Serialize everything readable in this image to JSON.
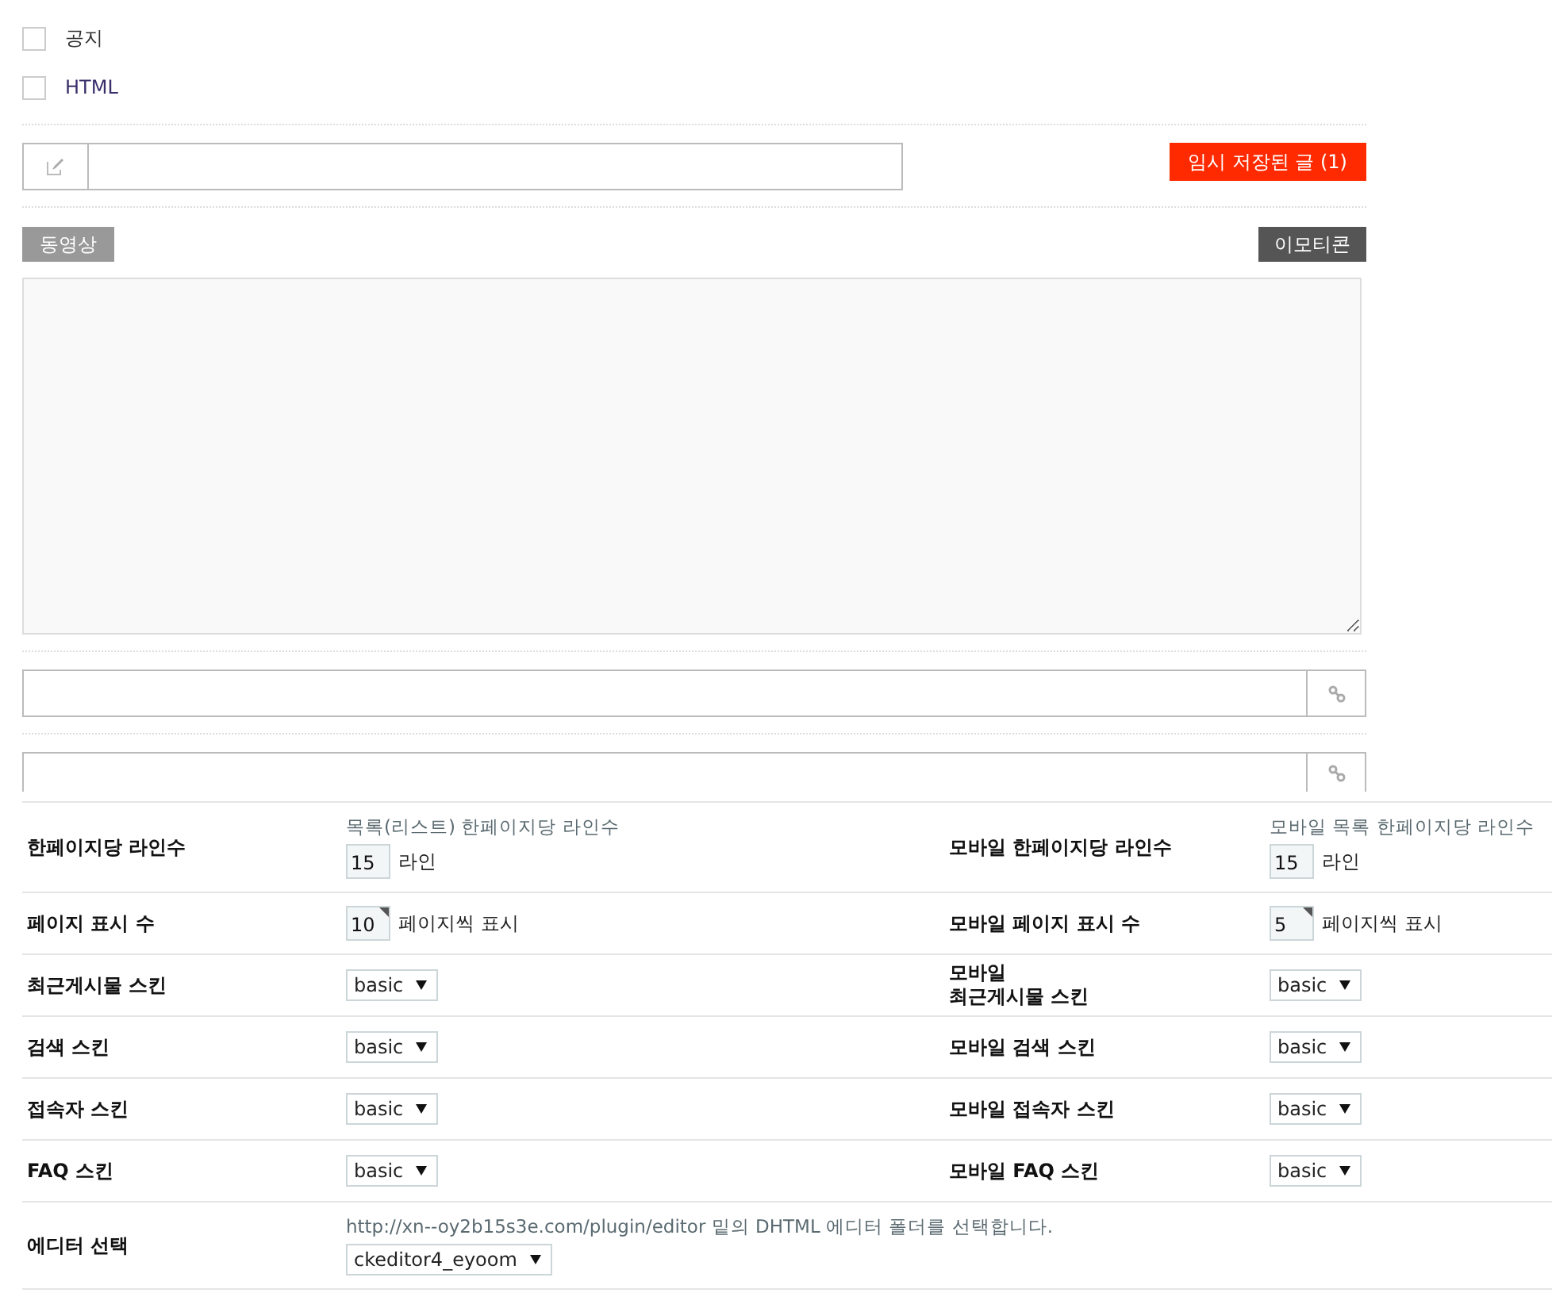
{
  "options": [
    {
      "label": "공지",
      "checked": false
    },
    {
      "label": "HTML",
      "checked": false
    }
  ],
  "temp_saved_button": "임시 저장된 글 (1)",
  "video_button": "동영상",
  "emoticon_button": "이모티콘",
  "settings": {
    "rows": [
      {
        "items": [
          {
            "label": "한페이지당 라인수",
            "help": "목록(리스트) 한페이지당 라인수",
            "kind": "number",
            "value": "15",
            "unit": "라인",
            "marked": false
          },
          {
            "label": "모바일 한페이지당 라인수",
            "help": "모바일 목록 한페이지당 라인수",
            "kind": "number",
            "value": "15",
            "unit": "라인",
            "marked": false
          }
        ]
      },
      {
        "items": [
          {
            "label": "페이지 표시 수",
            "kind": "number",
            "value": "10",
            "unit": "페이지씩 표시",
            "marked": true
          },
          {
            "label": "모바일 페이지 표시 수",
            "kind": "number",
            "value": "5",
            "unit": "페이지씩 표시",
            "marked": true
          }
        ]
      },
      {
        "items": [
          {
            "label": "최근게시물 스킨",
            "kind": "select",
            "value": "basic"
          },
          {
            "label": "모바일\n최근게시물 스킨",
            "kind": "select",
            "value": "basic"
          }
        ]
      },
      {
        "items": [
          {
            "label": "검색 스킨",
            "kind": "select",
            "value": "basic"
          },
          {
            "label": "모바일 검색 스킨",
            "kind": "select",
            "value": "basic"
          }
        ]
      },
      {
        "items": [
          {
            "label": "접속자 스킨",
            "kind": "select",
            "value": "basic"
          },
          {
            "label": "모바일 접속자 스킨",
            "kind": "select",
            "value": "basic"
          }
        ]
      },
      {
        "items": [
          {
            "label": "FAQ 스킨",
            "kind": "select",
            "value": "basic"
          },
          {
            "label": "모바일 FAQ 스킨",
            "kind": "select",
            "value": "basic"
          }
        ]
      },
      {
        "items": [
          {
            "label": "에디터 선택",
            "help": "http://xn--oy2b15s3e.com/plugin/editor 밑의 DHTML 에디터 폴더를 선택합니다.",
            "kind": "select",
            "value": "ckeditor4_eyoom"
          }
        ]
      }
    ]
  }
}
